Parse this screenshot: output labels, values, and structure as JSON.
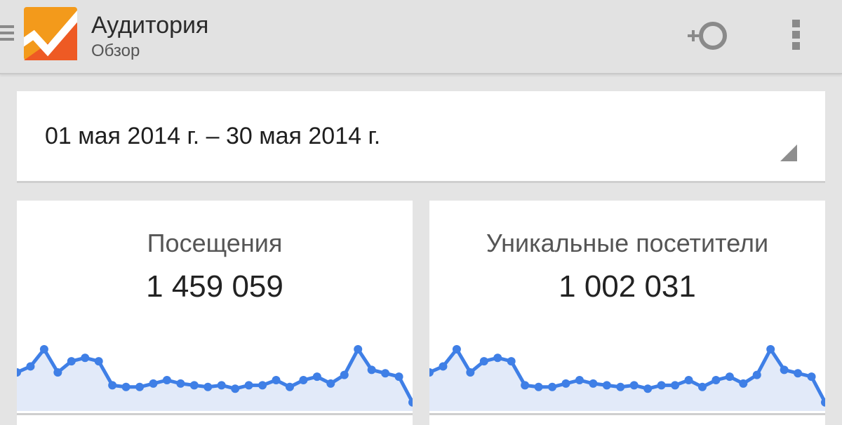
{
  "header": {
    "title": "Аудитория",
    "subtitle": "Обзор",
    "icons": [
      "menu-icon",
      "analytics-logo-icon",
      "add-segment-icon",
      "overflow-menu-icon"
    ]
  },
  "date_range": {
    "label": "01 мая 2014 г. – 30 мая 2014 г.",
    "icon": "dropdown-triangle-icon"
  },
  "metrics": [
    {
      "label": "Посещения",
      "value": "1 459 059"
    },
    {
      "label": "Уникальные посетители",
      "value": "1 002 031"
    }
  ],
  "colors": {
    "accent": "#3f7fe6",
    "fill": "#e2eaf9",
    "logo_orange": "#f39a1b",
    "logo_red": "#ee5a24"
  },
  "chart_data": [
    {
      "type": "area",
      "series": [
        {
          "values": [
            45,
            52,
            72,
            45,
            58,
            62,
            58,
            30,
            28,
            28,
            32,
            36,
            32,
            30,
            28,
            30,
            26,
            30,
            30,
            36,
            28,
            36,
            40,
            32,
            42,
            72,
            48,
            44,
            40,
            10
          ]
        }
      ],
      "ylim": [
        0,
        90
      ]
    },
    {
      "type": "area",
      "series": [
        {
          "values": [
            45,
            52,
            72,
            45,
            58,
            62,
            58,
            30,
            28,
            28,
            32,
            36,
            32,
            30,
            28,
            30,
            26,
            30,
            30,
            36,
            28,
            36,
            40,
            32,
            42,
            72,
            48,
            44,
            40,
            10
          ]
        }
      ],
      "ylim": [
        0,
        90
      ]
    }
  ]
}
